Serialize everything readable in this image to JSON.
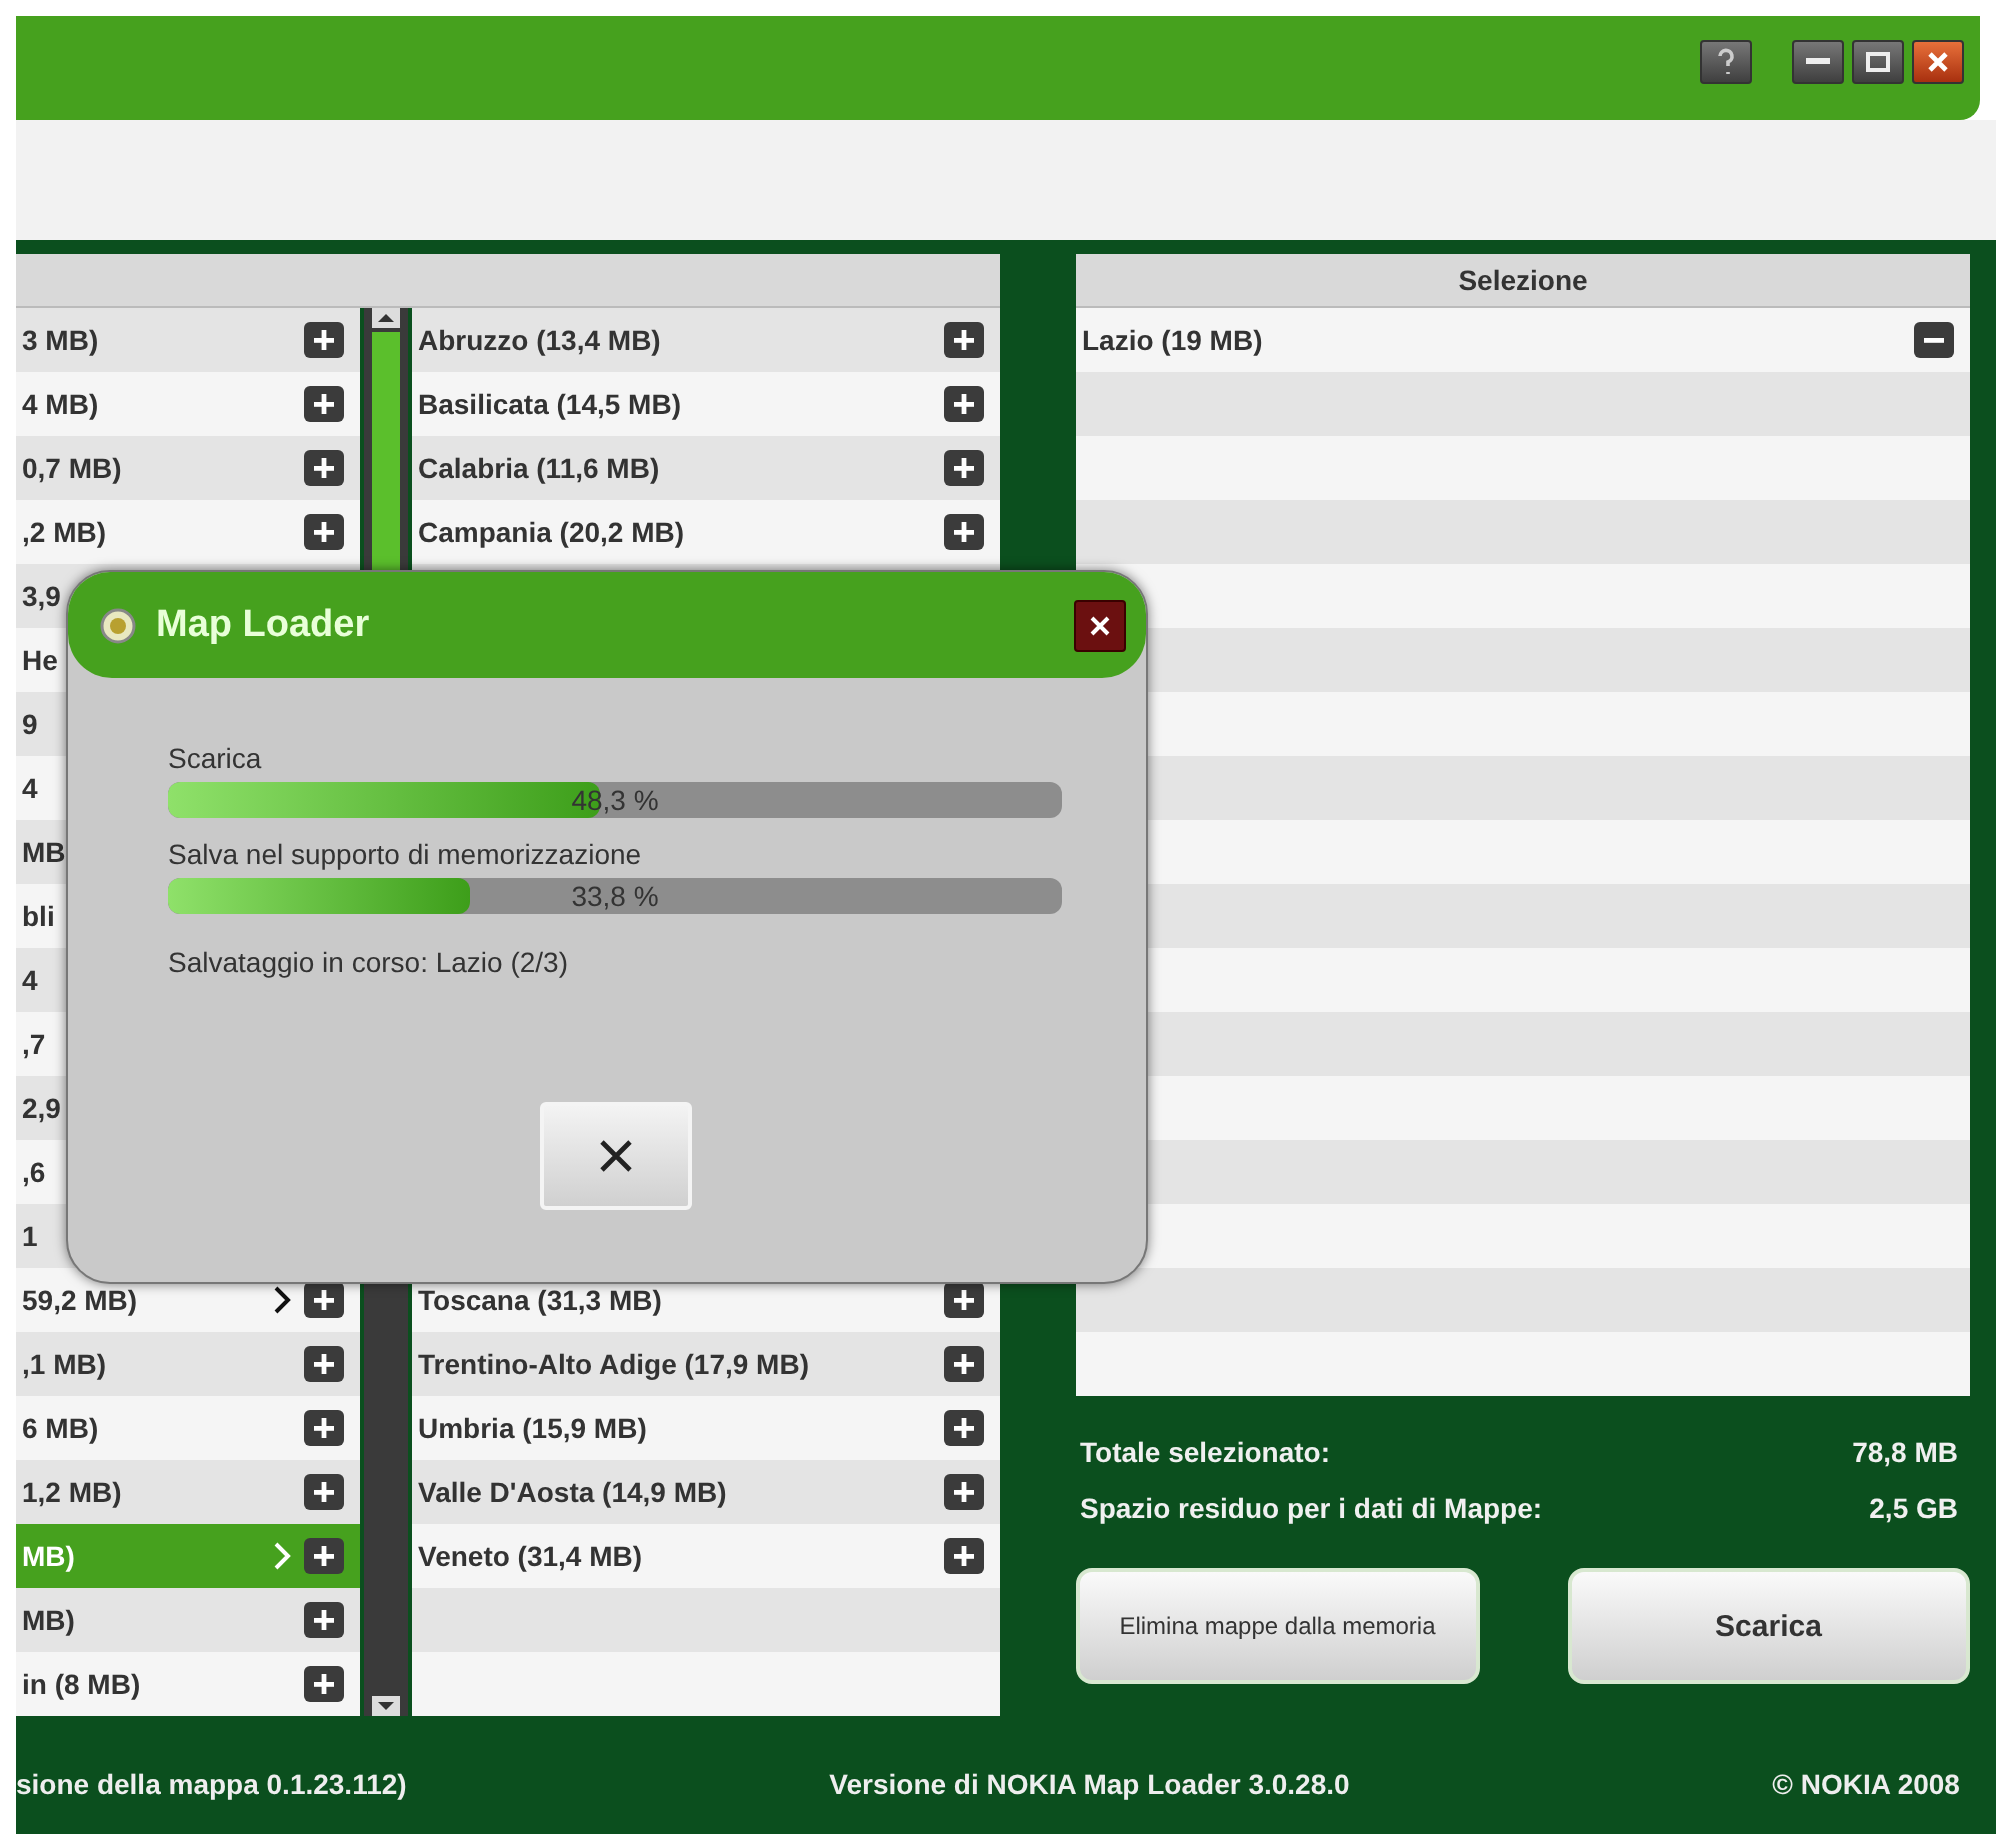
{
  "regions_list": {
    "rows": [
      {
        "text": "3 MB)",
        "submenu": false,
        "selected": false
      },
      {
        "text": "4 MB)",
        "submenu": false,
        "selected": false
      },
      {
        "text": "0,7 MB)",
        "submenu": false,
        "selected": false
      },
      {
        "text": ",2 MB)",
        "submenu": false,
        "selected": false
      },
      {
        "text": "3,9",
        "selected": false
      },
      {
        "text": "He",
        "selected": false
      },
      {
        "text": "9",
        "selected": false
      },
      {
        "text": "4",
        "selected": false
      },
      {
        "text": "MB",
        "selected": false
      },
      {
        "text": "bli",
        "selected": false
      },
      {
        "text": "4",
        "selected": false
      },
      {
        "text": ",7",
        "selected": false
      },
      {
        "text": "2,9",
        "selected": false
      },
      {
        "text": ",6",
        "selected": false
      },
      {
        "text": "1",
        "selected": false
      },
      {
        "text": "59,2 MB)",
        "submenu": true,
        "selected": false
      },
      {
        "text": ",1 MB)",
        "submenu": false,
        "selected": false
      },
      {
        "text": "6 MB)",
        "submenu": false,
        "selected": false
      },
      {
        "text": "1,2 MB)",
        "submenu": false,
        "selected": false
      },
      {
        "text": "MB)",
        "submenu": true,
        "selected": true
      },
      {
        "text": "MB)",
        "submenu": false,
        "selected": false
      },
      {
        "text": "in (8 MB)",
        "submenu": false,
        "selected": false
      }
    ]
  },
  "subregions_list": {
    "top_rows": [
      "Abruzzo (13,4 MB)",
      "Basilicata (14,5 MB)",
      "Calabria (11,6 MB)",
      "Campania (20,2 MB)"
    ],
    "bottom_rows": [
      "Toscana (31,3 MB)",
      "Trentino-Alto Adige (17,9 MB)",
      "Umbria (15,9 MB)",
      "Valle D'Aosta (14,9 MB)",
      "Veneto (31,4 MB)"
    ]
  },
  "selection": {
    "header": "Selezione",
    "rows": [
      "Lazio (19 MB)"
    ]
  },
  "totals": [
    {
      "label": "Totale selezionato:",
      "value": "78,8 MB"
    },
    {
      "label": "Spazio residuo per i dati di Mappe:",
      "value": "2,5 GB"
    }
  ],
  "buttons": [
    "Elimina mappe dalla memoria",
    "Scarica"
  ],
  "footer": [
    "sione della mappa 0.1.23.112)",
    "Versione di NOKIA Map Loader 3.0.28.0",
    "© NOKIA 2008"
  ],
  "dialog": {
    "title": "Map Loader",
    "progress": [
      {
        "label": "Scarica",
        "level": 0.483,
        "reading": "48,3 %"
      },
      {
        "label": "Salva nel supporto di memorizzazione",
        "level": 0.338,
        "reading": "33,8 %"
      }
    ],
    "status": "Salvataggio in corso: Lazio (2/3)"
  }
}
